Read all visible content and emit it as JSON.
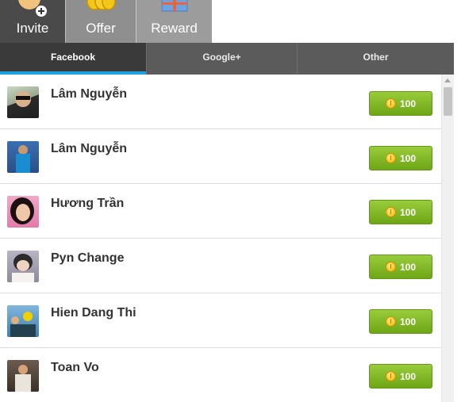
{
  "nav": {
    "tabs": [
      {
        "label": "Invite",
        "icon": "invite-avatar-plus-icon"
      },
      {
        "label": "Offer",
        "icon": "gold-coins-icon"
      },
      {
        "label": "Reward",
        "icon": "gift-box-icon"
      }
    ]
  },
  "subtabs": [
    {
      "label": "Facebook",
      "active": true
    },
    {
      "label": "Google+",
      "active": false
    },
    {
      "label": "Other",
      "active": false
    }
  ],
  "friends": [
    {
      "name": "Lâm Nguyễn",
      "reward": "100"
    },
    {
      "name": "Lâm Nguyễn",
      "reward": "100"
    },
    {
      "name": "Hương Trần",
      "reward": "100"
    },
    {
      "name": "Pyn Change",
      "reward": "100"
    },
    {
      "name": "Hien Dang Thi",
      "reward": "100"
    },
    {
      "name": "Toan Vo",
      "reward": "100"
    }
  ],
  "colors": {
    "button_green": "#7db524",
    "active_tab_underline": "#1ca0de",
    "subtab_bg": "#5b5b5b"
  }
}
